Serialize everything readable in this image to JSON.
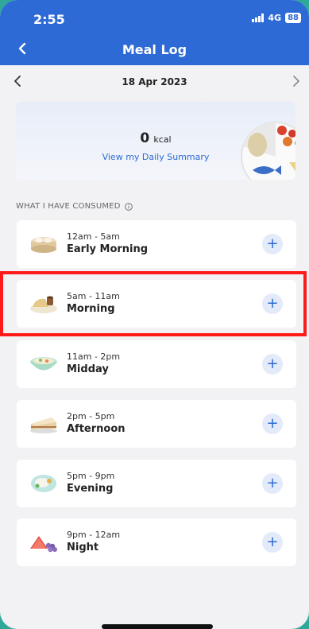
{
  "status_bar": {
    "time": "2:55",
    "network": "4G",
    "battery": "88"
  },
  "header": {
    "title": "Meal Log"
  },
  "date_nav": {
    "date": "18 Apr 2023"
  },
  "summary": {
    "kcal_value": "0",
    "kcal_unit": "kcal",
    "link": "View my Daily Summary"
  },
  "section": {
    "title": "WHAT I HAVE CONSUMED"
  },
  "meals": [
    {
      "time": "12am - 5am",
      "name": "Early Morning",
      "icon": "dumpling-basket-icon"
    },
    {
      "time": "5am - 11am",
      "name": "Morning",
      "icon": "toast-coffee-icon"
    },
    {
      "time": "11am - 2pm",
      "name": "Midday",
      "icon": "noodle-bowl-icon"
    },
    {
      "time": "2pm - 5pm",
      "name": "Afternoon",
      "icon": "cake-slice-icon"
    },
    {
      "time": "5pm - 9pm",
      "name": "Evening",
      "icon": "rice-plate-icon"
    },
    {
      "time": "9pm - 12am",
      "name": "Night",
      "icon": "fruit-icon"
    }
  ],
  "colors": {
    "primary": "#2d6ad5",
    "highlight": "#ff1a1a",
    "background": "#f2f2f4"
  }
}
